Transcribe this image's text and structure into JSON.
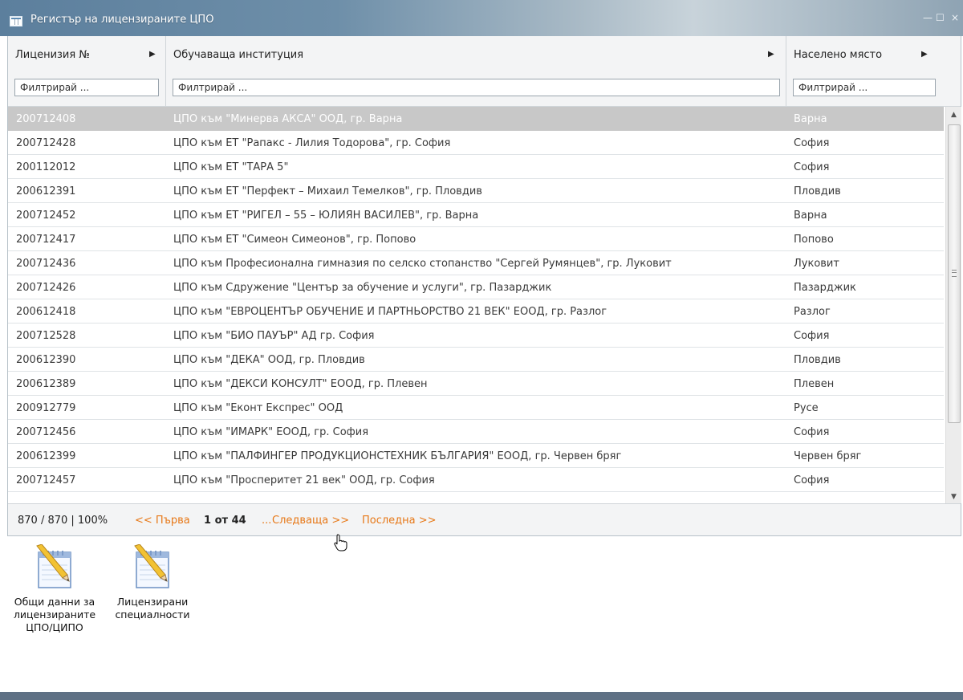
{
  "window": {
    "title": "Регистър на лицензираните ЦПО",
    "controls": {
      "minimize": "—",
      "maximize": "☐",
      "close": "×"
    }
  },
  "grid": {
    "columns": [
      {
        "label": "Лиценизия №",
        "filter_placeholder": "Филтрирай ..."
      },
      {
        "label": "Обучаваща институция",
        "filter_placeholder": "Филтрирай ..."
      },
      {
        "label": "Населено място",
        "filter_placeholder": "Филтрирай ..."
      }
    ],
    "rows": [
      {
        "license": "200712408",
        "institution": "ЦПО към \"Минерва АКСА\" ООД, гр. Варна",
        "city": "Варна",
        "selected": true
      },
      {
        "license": "200712428",
        "institution": "ЦПО към ЕТ \"Рапакс - Лилия Тодорова\", гр. София",
        "city": "София"
      },
      {
        "license": "200112012",
        "institution": "ЦПО към ЕТ \"ТАРА 5\"",
        "city": "София"
      },
      {
        "license": "200612391",
        "institution": "ЦПО към ЕТ \"Перфект – Михаил Темелков\", гр. Пловдив",
        "city": "Пловдив"
      },
      {
        "license": "200712452",
        "institution": "ЦПО към ЕТ \"РИГЕЛ – 55 – ЮЛИЯН ВАСИЛЕВ\", гр. Варна",
        "city": "Варна"
      },
      {
        "license": "200712417",
        "institution": "ЦПО към ЕТ \"Симеон Симеонов\", гр. Попово",
        "city": "Попово"
      },
      {
        "license": "200712436",
        "institution": "ЦПО към Професионална гимназия по селско стопанство \"Сергей Румянцев\", гр. Луковит",
        "city": "Луковит"
      },
      {
        "license": "200712426",
        "institution": "ЦПО към Сдружение \"Център за обучение и услуги\", гр. Пазарджик",
        "city": "Пазарджик"
      },
      {
        "license": "200612418",
        "institution": "ЦПО към \"ЕВРОЦЕНТЪР ОБУЧЕНИЕ И ПАРТНЬОРСТВО 21 ВЕК\" ЕООД, гр. Разлог",
        "city": "Разлог"
      },
      {
        "license": "200712528",
        "institution": "ЦПО към \"БИО ПАУЪР\" АД гр. София",
        "city": "София"
      },
      {
        "license": "200612390",
        "institution": "ЦПО към \"ДЕКА\" ООД, гр. Пловдив",
        "city": "Пловдив"
      },
      {
        "license": "200612389",
        "institution": "ЦПО към \"ДЕКСИ КОНСУЛТ\" ЕООД, гр. Плевен",
        "city": "Плевен"
      },
      {
        "license": "200912779",
        "institution": "ЦПО към \"Еконт Експрес\" ООД",
        "city": "Русе"
      },
      {
        "license": "200712456",
        "institution": "ЦПО към \"ИМАРК\" ЕООД, гр. София",
        "city": "София"
      },
      {
        "license": "200612399",
        "institution": "ЦПО към \"ПАЛФИНГЕР ПРОДУКЦИОНСТЕХНИК БЪЛГАРИЯ\" ЕООД, гр. Червен бряг",
        "city": "Червен бряг"
      },
      {
        "license": "200712457",
        "institution": "ЦПО към \"Просперитет 21 век\" ООД, гр. София",
        "city": "София"
      }
    ]
  },
  "pager": {
    "count": "870 / 870 | 100%",
    "first": "<< Първа",
    "position": "1 от 44",
    "dots": "...",
    "next": "Следваща >>",
    "last": "Последна >>"
  },
  "launchers": [
    {
      "label_line1": "Общи данни за",
      "label_line2": "лицензираните",
      "label_line3": "ЦПО/ЦИПО"
    },
    {
      "label_line1": "Лицензирани",
      "label_line2": "специалности"
    }
  ],
  "colors": {
    "link": "#e77817",
    "selected_row": "#c8c8c8",
    "titlebar": "#5c7f9d"
  }
}
